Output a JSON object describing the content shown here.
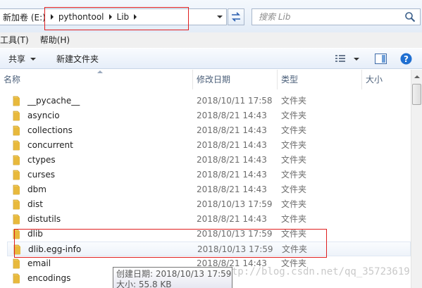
{
  "address": {
    "drive": "新加卷 (E:)",
    "path": [
      "pythontool",
      "Lib"
    ]
  },
  "search": {
    "placeholder": "搜索 Lib"
  },
  "menu": [
    "工具(T)",
    "帮助(H)"
  ],
  "toolbar": {
    "share": "共享",
    "new_folder": "新建文件夹"
  },
  "columns": {
    "name": "名称",
    "date": "修改日期",
    "type": "类型",
    "size": "大小"
  },
  "files": [
    {
      "name": "__pycache__",
      "date": "2018/10/11 17:58",
      "type": "文件夹"
    },
    {
      "name": "asyncio",
      "date": "2018/8/21 14:43",
      "type": "文件夹"
    },
    {
      "name": "collections",
      "date": "2018/8/21 14:43",
      "type": "文件夹"
    },
    {
      "name": "concurrent",
      "date": "2018/8/21 14:43",
      "type": "文件夹"
    },
    {
      "name": "ctypes",
      "date": "2018/8/21 14:43",
      "type": "文件夹"
    },
    {
      "name": "curses",
      "date": "2018/8/21 14:43",
      "type": "文件夹"
    },
    {
      "name": "dbm",
      "date": "2018/8/21 14:43",
      "type": "文件夹"
    },
    {
      "name": "dist",
      "date": "2018/10/13 17:59",
      "type": "文件夹"
    },
    {
      "name": "distutils",
      "date": "2018/8/21 14:43",
      "type": "文件夹"
    },
    {
      "name": "dlib",
      "date": "2018/10/13 17:59",
      "type": "文件夹"
    },
    {
      "name": "dlib.egg-info",
      "date": "2018/10/13 17:59",
      "type": "文件夹"
    },
    {
      "name": "email",
      "date": "2018/8/21 14:43",
      "type": "文件夹"
    },
    {
      "name": "encodings",
      "date": "",
      "type": ""
    }
  ],
  "tooltip": {
    "created": "创建日期: 2018/10/13 17:59",
    "size": "大小: 55.8 KB"
  },
  "watermark": "http://blog.csdn.net/qq_35723619",
  "colors": {
    "folder": "#e8b93c",
    "highlight_box": "#e01f1f",
    "help": "#1f6fd1"
  }
}
